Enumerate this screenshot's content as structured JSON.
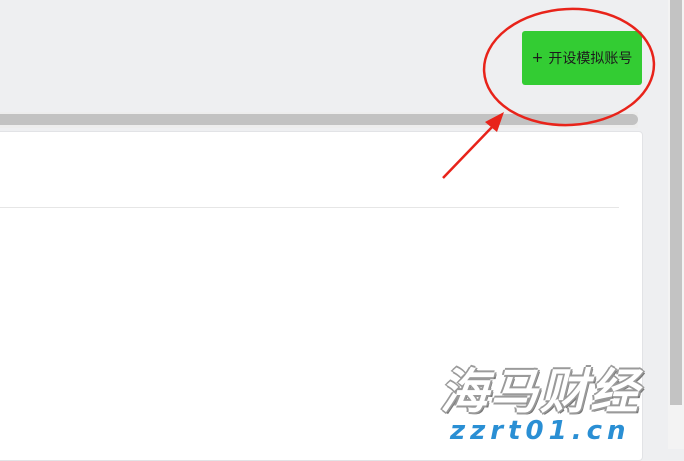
{
  "toolbar": {
    "open_demo_icon": "+",
    "open_demo_label": "开设模拟账号"
  },
  "annotation": {
    "circle_color": "#e8231a",
    "arrow_color": "#e8231a"
  },
  "watermark": {
    "brand": "海马财经",
    "url": "zzrt01.cn"
  }
}
